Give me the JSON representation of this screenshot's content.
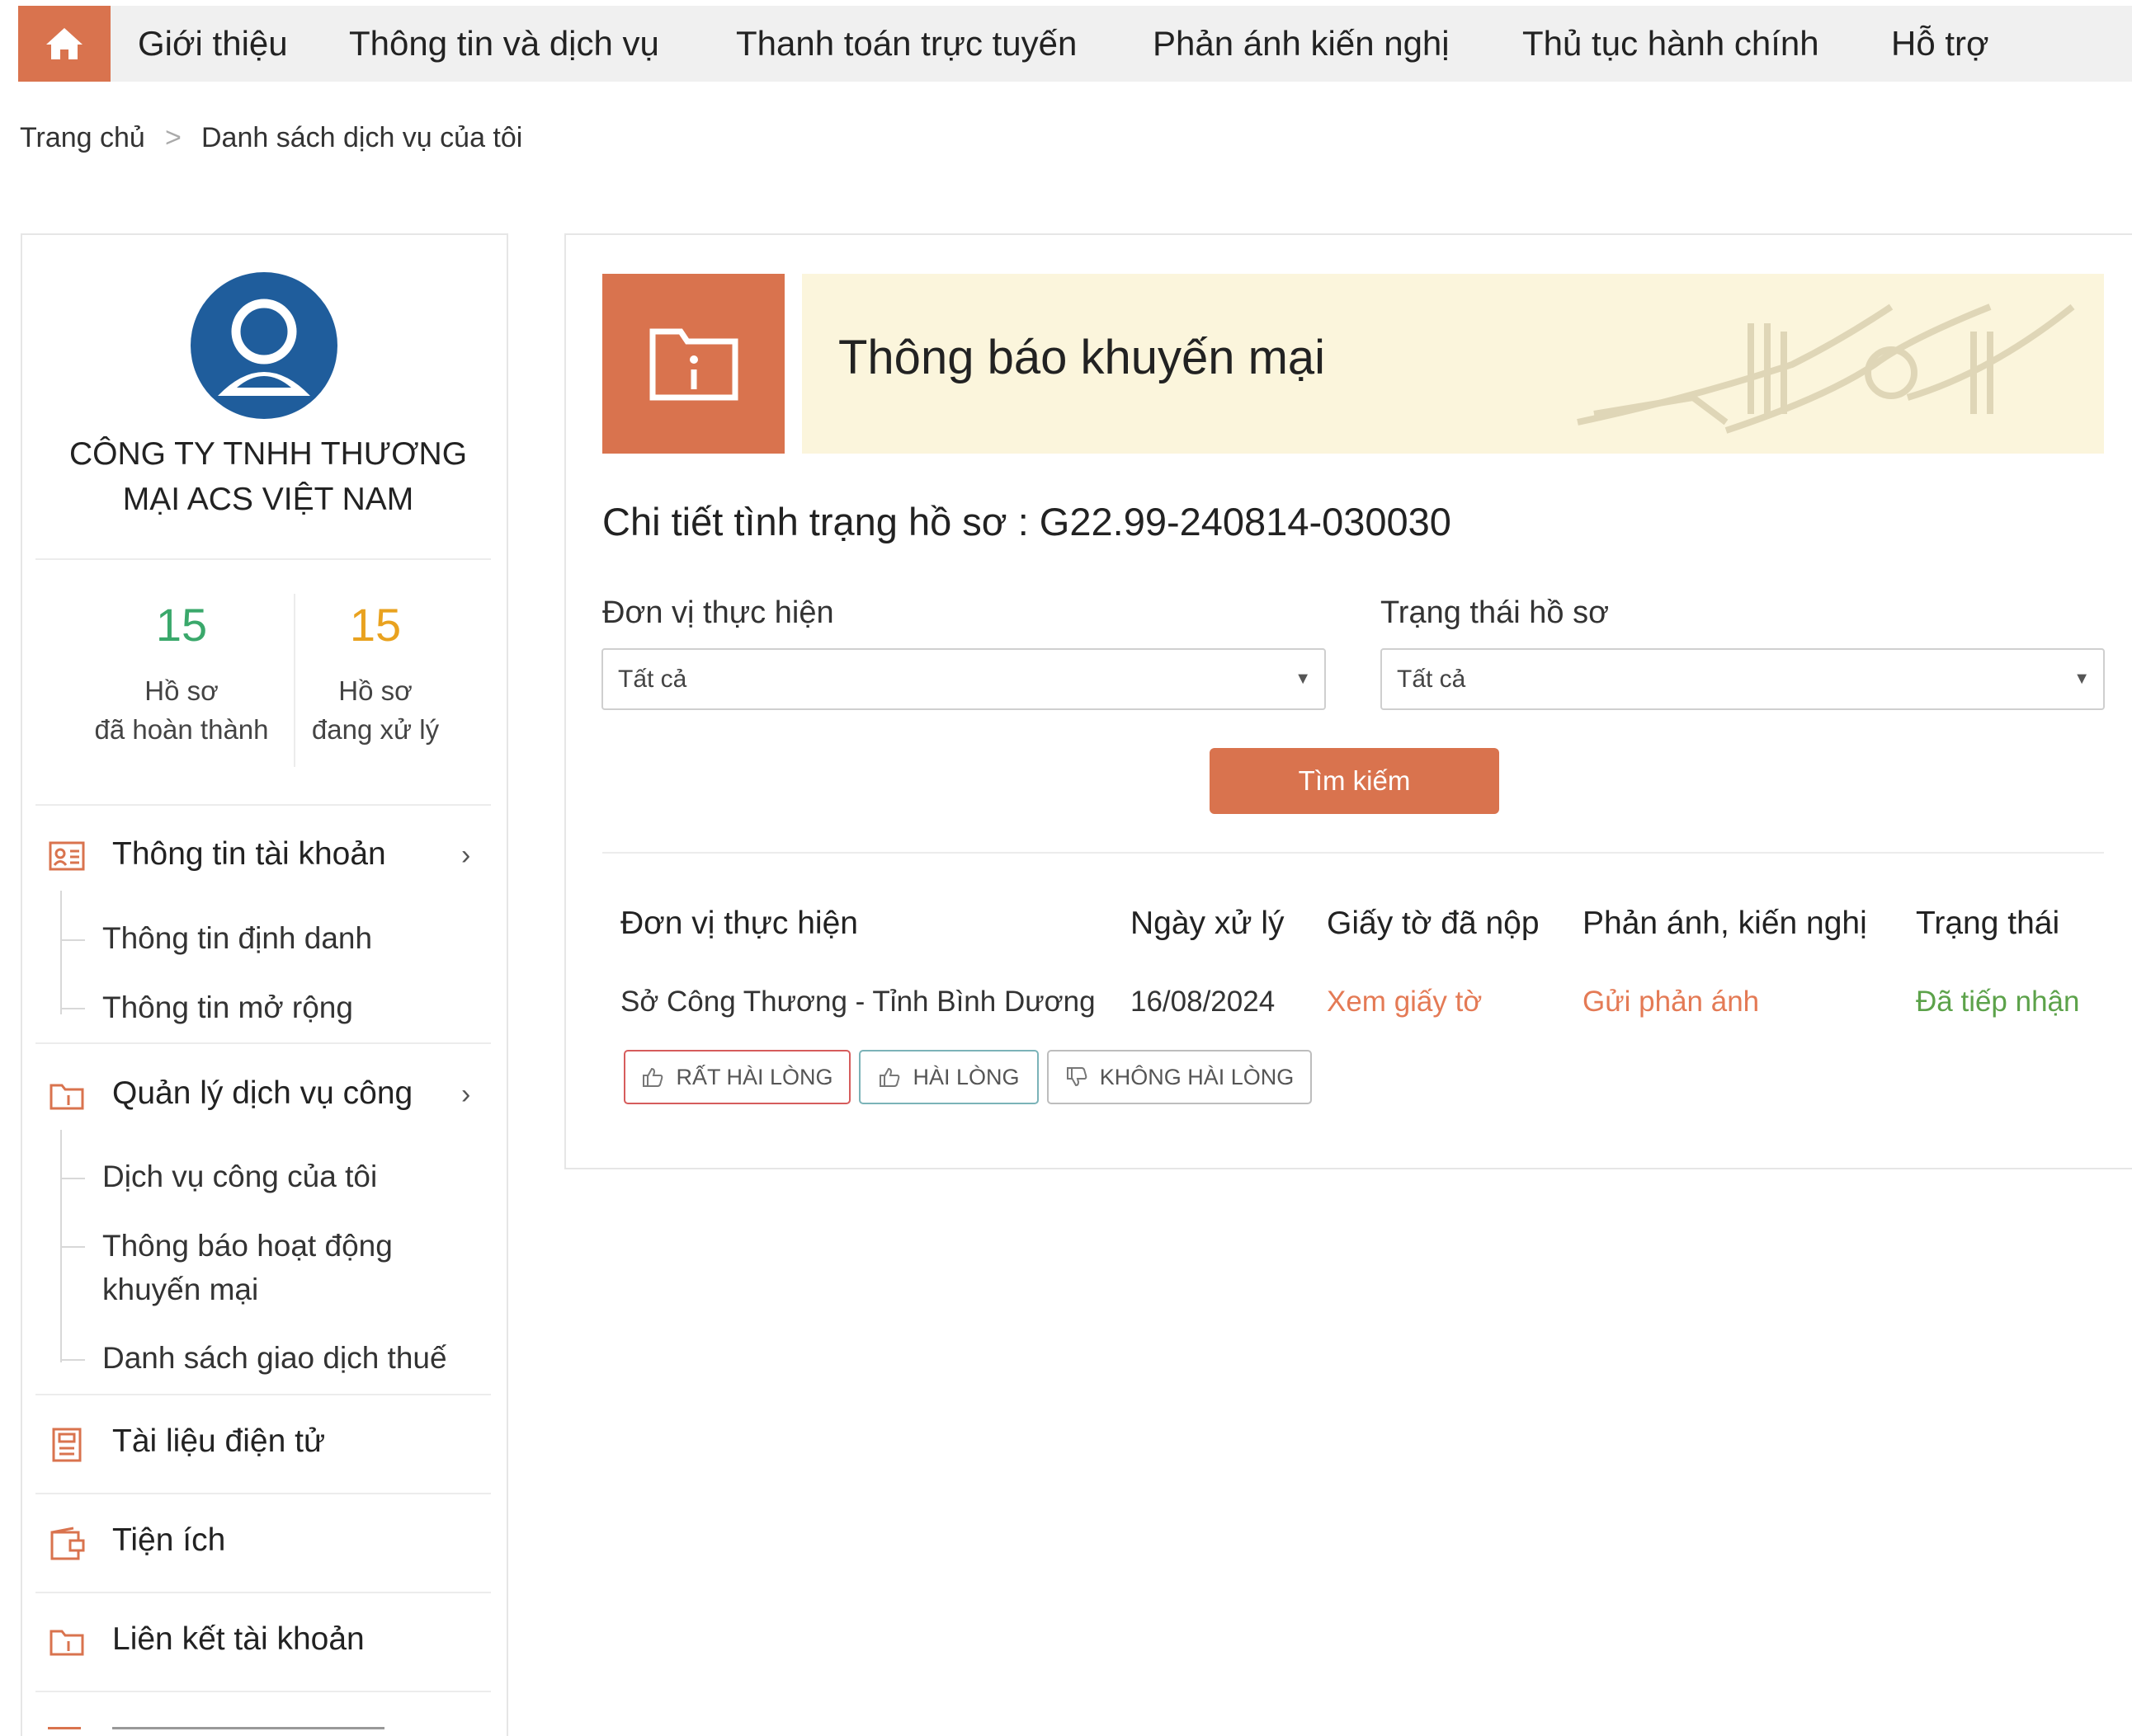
{
  "nav": {
    "items": [
      "Giới thiệu",
      "Thông tin và dịch vụ",
      "Thanh toán trực tuyến",
      "Phản ánh kiến nghị",
      "Thủ tục hành chính",
      "Hỗ trợ"
    ]
  },
  "breadcrumb": {
    "home": "Trang chủ",
    "sep": ">",
    "current": "Danh sách dịch vụ của tôi"
  },
  "profile": {
    "company_line1": "CÔNG TY TNHH THƯƠNG",
    "company_line2": "MẠI ACS VIỆT NAM"
  },
  "stats": {
    "completed": {
      "count": "15",
      "line1": "Hồ sơ",
      "line2": "đã hoàn thành"
    },
    "processing": {
      "count": "15",
      "line1": "Hồ sơ",
      "line2": "đang xử lý"
    }
  },
  "menu": {
    "account": {
      "label": "Thông tin tài khoản",
      "subs": [
        "Thông tin định danh",
        "Thông tin mở rộng"
      ]
    },
    "services": {
      "label": "Quản lý dịch vụ công",
      "subs": [
        "Dịch vụ công của tôi",
        "Thông báo hoạt động",
        "khuyến mại",
        "Danh sách giao dịch thuế"
      ]
    },
    "edocs": "Tài liệu điện tử",
    "utilities": "Tiện ích",
    "link_account": "Liên kết tài khoản"
  },
  "main": {
    "promo_title": "Thông báo khuyến mại",
    "detail_title": "Chi tiết tình trạng hồ sơ : G22.99-240814-030030",
    "filter_unit_label": "Đơn vị thực hiện",
    "filter_unit_value": "Tất cả",
    "filter_status_label": "Trạng thái hồ sơ",
    "filter_status_value": "Tất cả",
    "search_label": "Tìm kiếm",
    "table": {
      "headers": [
        "Đơn vị thực hiện",
        "Ngày xử lý",
        "Giấy tờ đã nộp",
        "Phản ánh, kiến nghị",
        "Trạng thái"
      ],
      "row": {
        "unit": "Sở Công Thương - Tỉnh Bình Dương",
        "date": "16/08/2024",
        "docs": "Xem giấy tờ",
        "feedback": "Gửi phản ánh",
        "status": "Đã tiếp nhận"
      }
    },
    "ratings": [
      "RẤT HÀI LÒNG",
      "HÀI LÒNG",
      "KHÔNG HÀI LÒNG"
    ]
  },
  "colors": {
    "accent": "#d9734e",
    "stat_completed": "#3aa86b",
    "stat_processing": "#e9a21f",
    "link_orange": "#e47a55",
    "status_green": "#5ca24a",
    "banner_bg": "#fbf5dc",
    "avatar_blue": "#1f5d9c"
  }
}
